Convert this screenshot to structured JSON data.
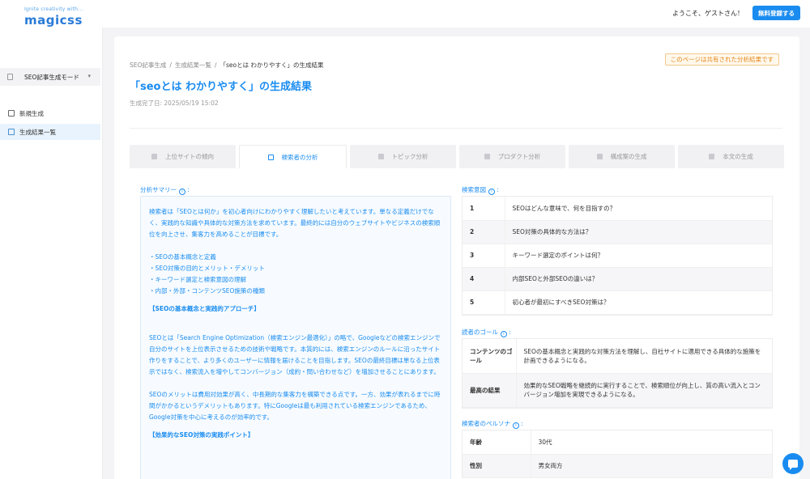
{
  "header": {
    "logo_tagline": "Ignite creativity with...",
    "logo_name": "magicss",
    "welcome": "ようこそ、ゲストさん！",
    "signup_label": "無料登録する"
  },
  "sidebar": {
    "mode_label": "SEO記事生成モード",
    "items": [
      {
        "label": "新規生成"
      },
      {
        "label": "生成結果一覧"
      }
    ]
  },
  "main": {
    "breadcrumbs": [
      "SEO記事生成",
      "生成結果一覧",
      "「seoとは わかりやすく」の生成結果"
    ],
    "shared_badge": "このページは共有された分析結果です",
    "title": "「seoとは わかりやすく」の生成結果",
    "completed_at": "生成完了日: 2025/05/19 15:02",
    "tabs": [
      {
        "label": "上位サイトの傾向"
      },
      {
        "label": "検索者の分析"
      },
      {
        "label": "トピック分析"
      },
      {
        "label": "プロダクト分析"
      },
      {
        "label": "構成案の生成"
      },
      {
        "label": "本文の生成"
      }
    ]
  },
  "summary": {
    "label": "分析サマリー",
    "paragraphs": [
      "検索者は「SEOとは何か」を初心者向けにわかりやすく理解したいと考えています。単なる定義だけでなく、実践的な知識や具体的な対策方法を求めています。最終的には自分のウェブサイトやビジネスの検索順位を向上させ、集客力を高めることが目標です。",
      "・SEOの基本概念と定義",
      "・SEO対策の目的とメリット・デメリット",
      "・キーワード選定と検索意図の理解",
      "・内部・外部・コンテンツSEO施策の種類",
      "【SEOの基本概念と実践的アプローチ】",
      "SEOとは「Search Engine Optimization（検索エンジン最適化）」の略で、Googleなどの検索エンジンで自分のサイトを上位表示させるための技術や戦略です。本質的には、検索エンジンのルールに沿ったサイト作りをすることで、より多くのユーザーに情報を届けることを目指します。SEOの最終目標は単なる上位表示ではなく、検索流入を増やしてコンバージョン（成約・問い合わせなど）を増加させることにあります。",
      "SEOのメリットは費用対効果が高く、中長期的な集客力を構築できる点です。一方、効果が表れるまでに時間がかかるというデメリットもあります。特にGoogleは最も利用されている検索エンジンであるため、Google対策を中心に考えるのが効率的です。",
      "【効果的なSEO対策の実践ポイント】"
    ]
  },
  "intent": {
    "label": "検索意図",
    "rows": [
      {
        "num": "1",
        "text": "SEOはどんな意味で、何を目指すの？"
      },
      {
        "num": "2",
        "text": "SEO対策の具体的な方法は？"
      },
      {
        "num": "3",
        "text": "キーワード選定のポイントは何？"
      },
      {
        "num": "4",
        "text": "内部SEOと外部SEOの違いは？"
      },
      {
        "num": "5",
        "text": "初心者が最初にすべきSEO対策は？"
      }
    ]
  },
  "goal": {
    "label": "読者のゴール",
    "rows": [
      {
        "key": "コンテンツのゴール",
        "value": "SEOの基本概念と実践的な対策方法を理解し、自社サイトに適用できる具体的な施策を計画できるようになる。"
      },
      {
        "key": "最高の結果",
        "value": "効果的なSEO戦略を継続的に実行することで、検索順位が向上し、質の高い流入とコンバージョン増加を実現できるようになる。"
      }
    ]
  },
  "persona": {
    "label": "検索者のペルソナ",
    "rows": [
      {
        "key": "年齢",
        "value": "30代"
      },
      {
        "key": "性別",
        "value": "男女両方"
      }
    ]
  }
}
